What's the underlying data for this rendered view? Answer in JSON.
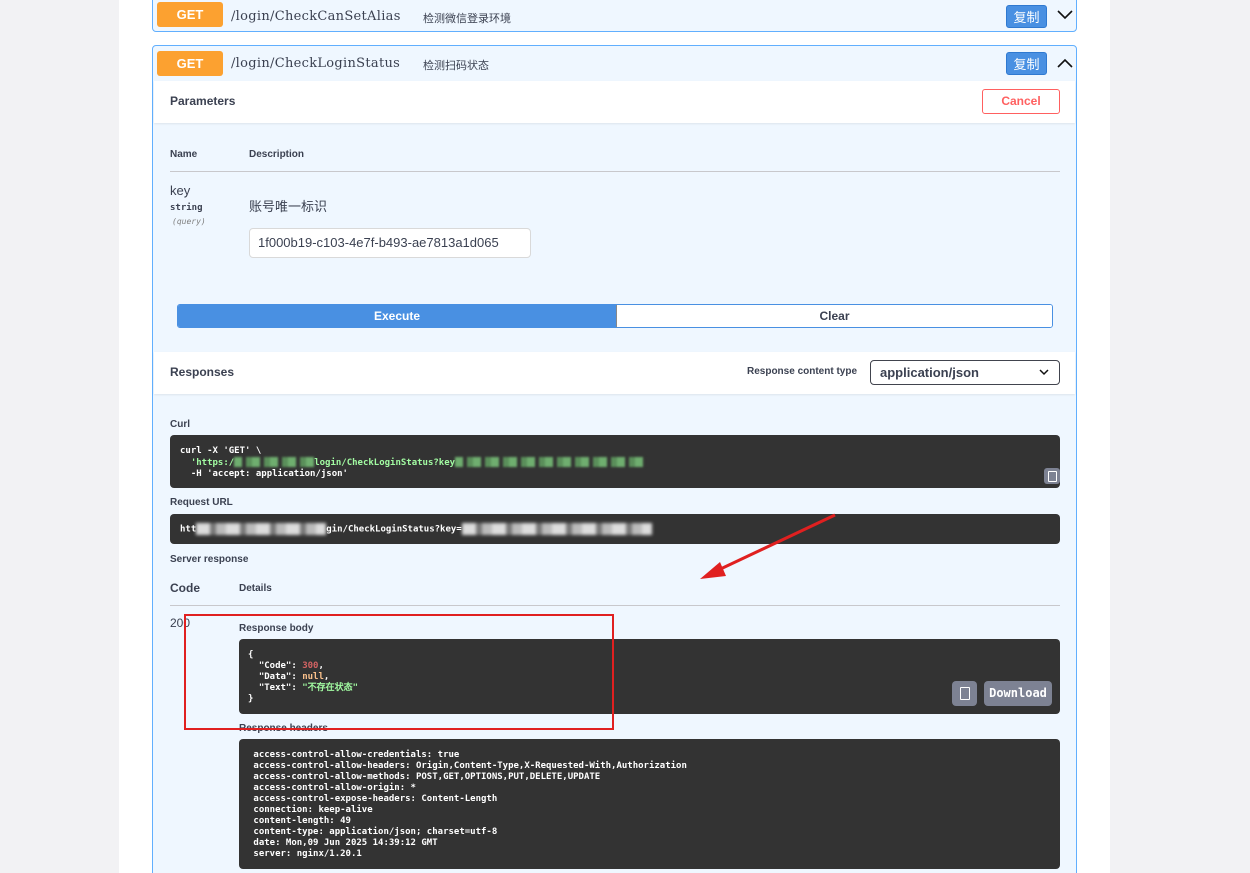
{
  "collapsed_op": {
    "method": "GET",
    "path": "/login/CheckCanSetAlias",
    "description": "检测微信登录环境",
    "copy_label": "复制",
    "chevron_icon": "chevron-down-icon"
  },
  "expanded_op": {
    "method": "GET",
    "path": "/login/CheckLoginStatus",
    "description": "检测扫码状态",
    "copy_label": "复制",
    "chevron_icon": "chevron-up-icon"
  },
  "parameters": {
    "title": "Parameters",
    "cancel_label": "Cancel",
    "col_name": "Name",
    "col_description": "Description",
    "param": {
      "name": "key",
      "type": "string",
      "in": "(query)",
      "description": "账号唯一标识",
      "value": "1f000b19-c103-4e7f-b493-ae7813a1d065"
    },
    "execute_label": "Execute",
    "clear_label": "Clear"
  },
  "responses": {
    "title": "Responses",
    "content_type_label": "Response content type",
    "content_type_value": "application/json",
    "curl_label": "Curl",
    "curl_line1": "curl -X 'GET' \\",
    "curl_line2_prefix": "  'https:/",
    "curl_line2_mid": "login/CheckLoginStatus?key",
    "curl_line3": "  -H 'accept: application/json'",
    "request_url_label": "Request URL",
    "request_url_prefix": "htt",
    "request_url_mid": "gin/CheckLoginStatus?key=",
    "server_response_label": "Server response",
    "col_code": "Code",
    "col_details": "Details",
    "code": "200",
    "response_body_label": "Response body",
    "body": {
      "open": "{",
      "code_key": "  \"Code\": ",
      "code_val": "300",
      "data_key": "  \"Data\": ",
      "data_val": "null",
      "text_key": "  \"Text\": ",
      "text_val": "\"不存在状态\"",
      "close": "}"
    },
    "download_label": "Download",
    "response_headers_label": "Response headers",
    "headers": [
      " access-control-allow-credentials: true ",
      " access-control-allow-headers: Origin,Content-Type,X-Requested-With,Authorization ",
      " access-control-allow-methods: POST,GET,OPTIONS,PUT,DELETE,UPDATE ",
      " access-control-allow-origin: * ",
      " access-control-expose-headers: Content-Length ",
      " connection: keep-alive ",
      " content-length: 49 ",
      " content-type: application/json; charset=utf-8 ",
      " date: Mon,09 Jun 2025 14:39:12 GMT ",
      " server: nginx/1.20.1 "
    ]
  },
  "annotation_colors": {
    "highlight_box": "#e02020",
    "arrow": "#e02020"
  }
}
